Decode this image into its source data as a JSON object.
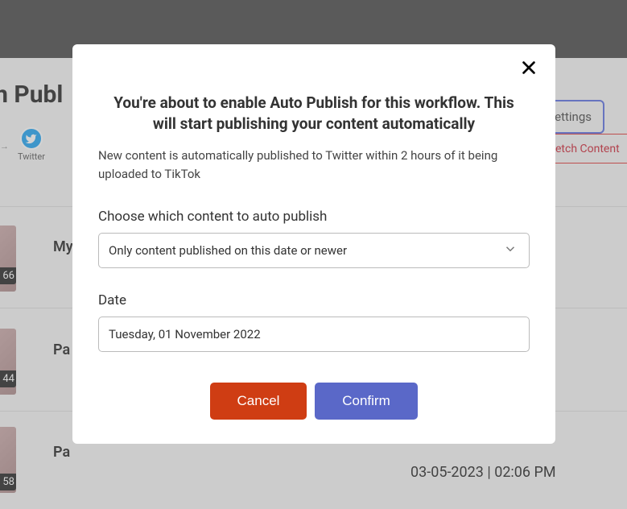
{
  "background": {
    "page_title_fragment": "d In Publ",
    "arrow": "→",
    "twitter_label": "Twitter",
    "settings_btn_fragment": "ettings",
    "fetch_btn_fragment": "etch Content",
    "rows": [
      {
        "badge": "66",
        "title": "My"
      },
      {
        "badge": "44",
        "title": "Pa"
      },
      {
        "badge": "58",
        "title": "Pa"
      }
    ],
    "timestamp": "03-05-2023 | 02:06 PM"
  },
  "modal": {
    "heading": "You're about to enable Auto Publish for this workflow. This will start publishing your content automatically",
    "description": "New content is automatically published to Twitter within 2 hours of it being uploaded to TikTok",
    "select_label": "Choose which content to auto publish",
    "select_value": "Only content published on this date or newer",
    "date_label": "Date",
    "date_value": "Tuesday, 01 November 2022",
    "cancel": "Cancel",
    "confirm": "Confirm"
  }
}
